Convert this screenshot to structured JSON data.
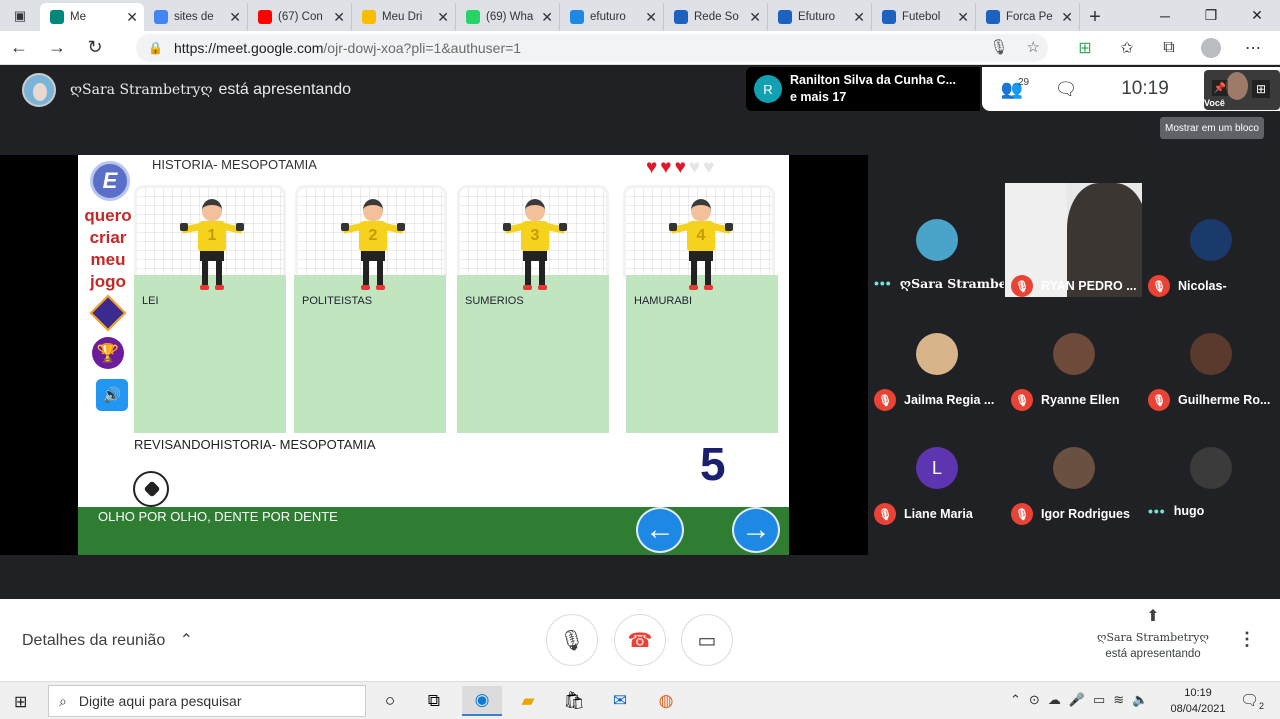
{
  "browser": {
    "tabs": [
      {
        "label": "Me",
        "color": "#00897b",
        "active": true
      },
      {
        "label": "sites de",
        "color": "#4285f4"
      },
      {
        "label": "(67) Con",
        "color": "#ff0000"
      },
      {
        "label": "Meu Dri",
        "color": "#fbbc04"
      },
      {
        "label": "(69) Wha",
        "color": "#25d366"
      },
      {
        "label": "efuturo",
        "color": "#1e88e5"
      },
      {
        "label": "Rede So",
        "color": "#1e62c0"
      },
      {
        "label": "Efuturo",
        "color": "#1e62c0"
      },
      {
        "label": "Futebol",
        "color": "#1e62c0"
      },
      {
        "label": "Forca Pe",
        "color": "#1e62c0"
      }
    ],
    "url_host": "https://meet.google.com",
    "url_path": "/ojr-dowj-xoa?pli=1&authuser=1"
  },
  "meet": {
    "presenter_name": "ღSara Strambetryღ",
    "presenter_suffix": "está apresentando",
    "chat_chip": {
      "initial": "R",
      "line1": "Ranilton Silva da Cunha C...",
      "line2": "e mais 17"
    },
    "people_count": "29",
    "time": "10:19",
    "self_label": "Você",
    "tooltip": "Mostrar em um bloco",
    "participants": [
      {
        "name": "ღSara Strambe...",
        "state": "dots"
      },
      {
        "name": "RYAN PEDRO ...",
        "state": "muted"
      },
      {
        "name": "Nicolas-",
        "state": "muted"
      },
      {
        "name": "Jailma Regia ...",
        "state": "muted"
      },
      {
        "name": "Ryanne Ellen",
        "state": "muted"
      },
      {
        "name": "Guilherme Ro...",
        "state": "muted"
      },
      {
        "name": "Liane Maria",
        "state": "muted"
      },
      {
        "name": "Igor Rodrigues",
        "state": "muted"
      },
      {
        "name": "hugo",
        "state": "dots"
      }
    ],
    "liane_initial": "L",
    "details_label": "Detalhes da reunião",
    "present_name": "ღSara Strambetryღ",
    "present_suffix": "está apresentando"
  },
  "game": {
    "title": "HISTORIA- MESOPOTAMIA",
    "hearts_full": 3,
    "hearts_total": 5,
    "side_text": [
      "quero",
      "criar",
      "meu",
      "jogo"
    ],
    "logo_letter": "E",
    "keepers": [
      {
        "number": "1",
        "option": "LEI"
      },
      {
        "number": "2",
        "option": "POLITEISTAS"
      },
      {
        "number": "3",
        "option": "SUMERIOS"
      },
      {
        "number": "4",
        "option": "HAMURABI"
      }
    ],
    "subtitle": "REVISANDOHISTORIA- MESOPOTAMIA",
    "count": "5",
    "answer": "OLHO POR OLHO, DENTE POR DENTE"
  },
  "taskbar": {
    "search_placeholder": "Digite aqui para pesquisar",
    "time": "10:19",
    "date": "08/04/2021",
    "notif_count": "2"
  }
}
